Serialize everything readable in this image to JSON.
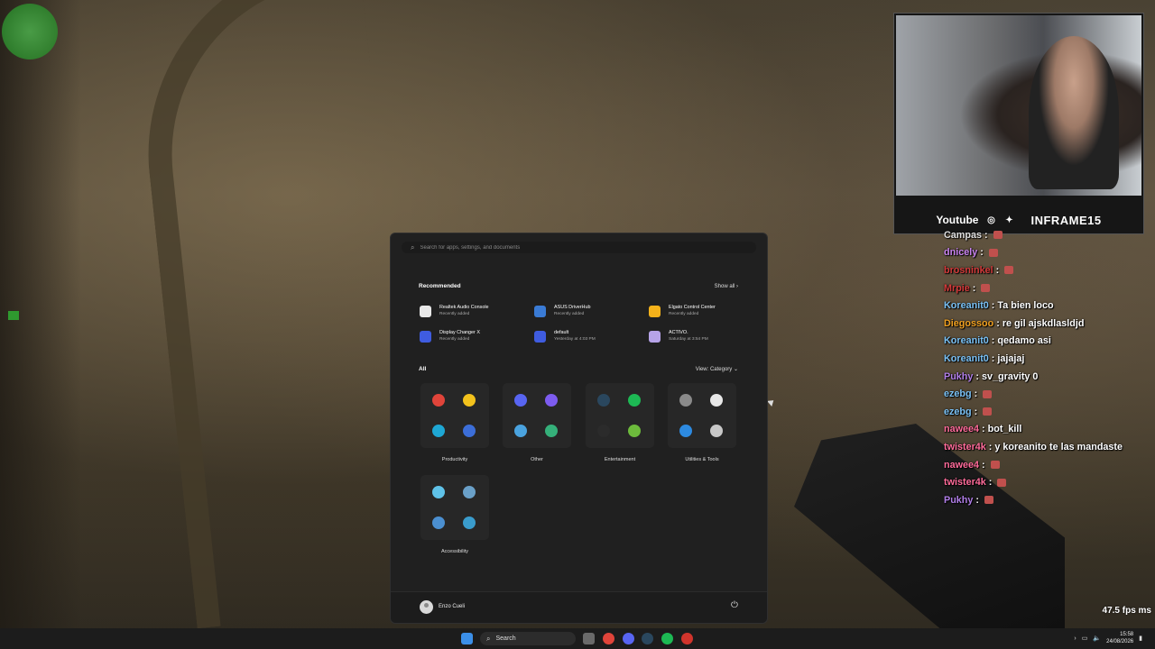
{
  "webcam": {
    "youtube_label": "Youtube",
    "instagram_icon": "instagram-icon",
    "twitter_icon": "twitter-icon",
    "channel_name": "INFRAME15"
  },
  "chat": [
    {
      "user": "Campas",
      "message": "",
      "color": "#e0e0e0",
      "emote": true
    },
    {
      "user": "dnicely",
      "message": "",
      "color": "#c983f0",
      "emote": true
    },
    {
      "user": "brosninkel",
      "message": "",
      "color": "#d43a3a",
      "emote": true
    },
    {
      "user": "Mrpie",
      "message": "",
      "color": "#d43a3a",
      "emote": true
    },
    {
      "user": "Koreanit0",
      "message": "Ta bien loco",
      "color": "#7ac1f5",
      "emote": false
    },
    {
      "user": "Diegossoo",
      "message": "re gil ajskdlasldjd",
      "color": "#f0a020",
      "emote": false
    },
    {
      "user": "Koreanit0",
      "message": "qedamo asi",
      "color": "#7ac1f5",
      "emote": false
    },
    {
      "user": "Koreanit0",
      "message": "jajajaj",
      "color": "#7ac1f5",
      "emote": false
    },
    {
      "user": "Pukhy",
      "message": "sv_gravity 0",
      "color": "#b17ee8",
      "emote": false
    },
    {
      "user": "ezebg",
      "message": "",
      "color": "#7ac1f5",
      "emote": true
    },
    {
      "user": "ezebg",
      "message": "",
      "color": "#7ac1f5",
      "emote": true
    },
    {
      "user": "nawee4",
      "message": "bot_kill",
      "color": "#ff6b9a",
      "emote": false
    },
    {
      "user": "twister4k",
      "message": "y koreanito te las mandaste",
      "color": "#ff6b9a",
      "emote": false
    },
    {
      "user": "nawee4",
      "message": "",
      "color": "#ff6b9a",
      "emote": true
    },
    {
      "user": "twister4k",
      "message": "",
      "color": "#ff6b9a",
      "emote": true
    },
    {
      "user": "Pukhy",
      "message": "",
      "color": "#b17ee8",
      "emote": true
    }
  ],
  "start_menu": {
    "search_placeholder": "Search for apps, settings, and documents",
    "recommended_title": "Recommended",
    "show_all_label": "Show all  ›",
    "recommended": [
      {
        "name": "Realtek Audio Console",
        "sub": "Recently added",
        "color": "#e8e8e8"
      },
      {
        "name": "ASUS DriverHub",
        "sub": "Recently added",
        "color": "#3a7bd5"
      },
      {
        "name": "Elgato Control Center",
        "sub": "Recently added",
        "color": "#f5b21a"
      },
      {
        "name": "Display Changer X",
        "sub": "Recently added",
        "color": "#3f5ce0"
      },
      {
        "name": "default",
        "sub": "Yesterday at 4:03 PM",
        "color": "#3f5ce0"
      },
      {
        "name": "ACTIVO.",
        "sub": "Saturday at 3:54 PM",
        "color": "#b6a3e8"
      }
    ],
    "all_title": "All",
    "view_label": "View: Category  ⌄",
    "folders": [
      {
        "label": "Productivity",
        "apps": [
          {
            "icon": "chrome-icon",
            "color": "#e0443a"
          },
          {
            "icon": "file-explorer-icon",
            "color": "#f3c21c"
          },
          {
            "icon": "edge-icon",
            "color": "#1ea7d4"
          },
          {
            "icon": "office-icon",
            "color": "#3c6ed8"
          }
        ]
      },
      {
        "label": "Other",
        "apps": [
          {
            "icon": "discord-icon",
            "color": "#5865f2"
          },
          {
            "icon": "apps-grid-icon",
            "color": "#7d5cf0"
          },
          {
            "icon": "settings-app-icon",
            "color": "#4aa3df"
          },
          {
            "icon": "store-icon",
            "color": "#35b07a"
          }
        ]
      },
      {
        "label": "Entertainment",
        "apps": [
          {
            "icon": "steam-icon",
            "color": "#2a475e"
          },
          {
            "icon": "spotify-icon",
            "color": "#1db954"
          },
          {
            "icon": "epic-games-icon",
            "color": "#2b2b2b"
          },
          {
            "icon": "xbox-icon",
            "color": "#6dbb3c"
          }
        ]
      },
      {
        "label": "Utilities & Tools",
        "apps": [
          {
            "icon": "settings-icon",
            "color": "#8a8a8a"
          },
          {
            "icon": "clock-icon",
            "color": "#e8e8e8"
          },
          {
            "icon": "help-icon",
            "color": "#2d8ae0"
          },
          {
            "icon": "tools-icon",
            "color": "#c8c8c8"
          }
        ]
      },
      {
        "label": "Accessibility",
        "apps": [
          {
            "icon": "narrator-icon",
            "color": "#5fc2e8"
          },
          {
            "icon": "magnifier-icon",
            "color": "#6aa0c8"
          },
          {
            "icon": "voice-access-icon",
            "color": "#4b8fd0"
          },
          {
            "icon": "on-screen-keyboard-icon",
            "color": "#3a9ccc"
          }
        ]
      }
    ],
    "user_name": "Enzo Cueli"
  },
  "taskbar": {
    "search_label": "Search",
    "date": "24/08/2026",
    "time": "15:58"
  },
  "hud": {
    "fps": "47.5 fps ms"
  }
}
